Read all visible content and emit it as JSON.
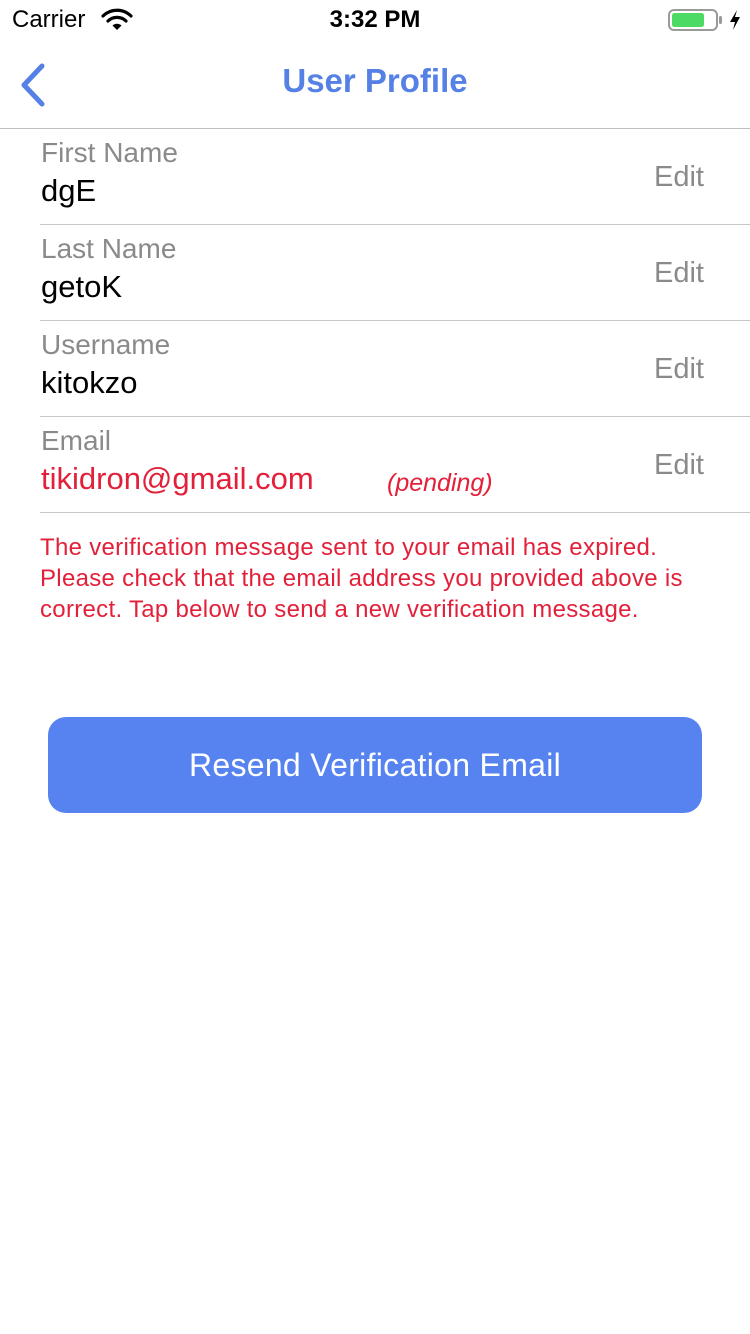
{
  "status_bar": {
    "carrier": "Carrier",
    "time": "3:32 PM",
    "icons": [
      "wifi-icon",
      "battery-icon",
      "charging-icon"
    ],
    "battery_level": 0.75
  },
  "nav": {
    "title": "User Profile",
    "back_icon": "chevron-left-icon"
  },
  "profile": {
    "rows": [
      {
        "label": "First Name",
        "value": "dgE",
        "action": "Edit"
      },
      {
        "label": "Last Name",
        "value": "getoK",
        "action": "Edit"
      },
      {
        "label": "Username",
        "value": "kitokzo",
        "action": "Edit"
      },
      {
        "label": "Email",
        "value": "tikidron@gmail.com",
        "status": "(pending)",
        "action": "Edit"
      }
    ]
  },
  "warning_message": "The verification message sent to your email has expired. Please check that the email address you provided above is correct. Tap below to send a new verification message.",
  "resend_button": {
    "label": "Resend Verification Email"
  },
  "colors": {
    "accent": "#5580e6",
    "button": "#5683f0",
    "error": "#e3203a",
    "secondary_text": "#8a8a8a",
    "battery_green": "#4cd964"
  }
}
